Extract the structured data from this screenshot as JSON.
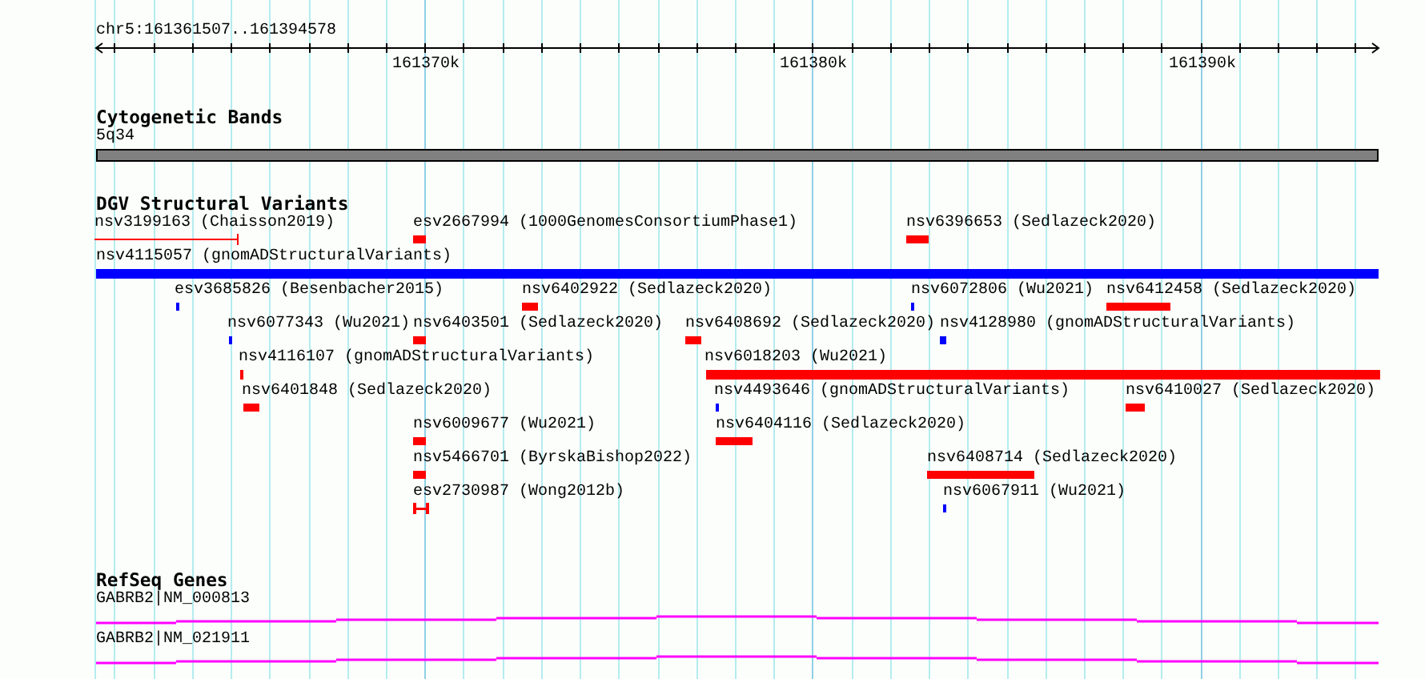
{
  "ruler": {
    "location": "chr5:161361507..161394578",
    "ticks": [
      "161370k",
      "161380k",
      "161390k"
    ]
  },
  "tracks": [
    {
      "kind": "bands",
      "title": "Cytogenetic Bands",
      "bands": [
        {
          "name": "5q34"
        }
      ]
    },
    {
      "kind": "variants",
      "title": "DGV Structural Variants",
      "features": [
        {
          "label": "nsv3199163 (Chaisson2019)",
          "color": "#ff0000",
          "kind": "line"
        },
        {
          "label": "esv2667994 (1000GenomesConsortiumPhase1)",
          "color": "#ff0000",
          "kind": "bar"
        },
        {
          "label": "nsv6396653 (Sedlazeck2020)",
          "color": "#ff0000",
          "kind": "bar"
        },
        {
          "label": "nsv4115057 (gnomADStructuralVariants)",
          "color": "#0000ff",
          "kind": "bar"
        },
        {
          "label": "esv3685826 (Besenbacher2015)",
          "color": "#0000ff",
          "kind": "bar"
        },
        {
          "label": "nsv6402922 (Sedlazeck2020)",
          "color": "#ff0000",
          "kind": "bar"
        },
        {
          "label": "nsv6072806 (Wu2021)",
          "color": "#0000ff",
          "kind": "bar"
        },
        {
          "label": "nsv6412458 (Sedlazeck2020)",
          "color": "#ff0000",
          "kind": "bar"
        },
        {
          "label": "nsv6077343 (Wu2021)",
          "color": "#0000ff",
          "kind": "bar"
        },
        {
          "label": "nsv6403501 (Sedlazeck2020)",
          "color": "#ff0000",
          "kind": "bar"
        },
        {
          "label": "nsv6408692 (Sedlazeck2020)",
          "color": "#ff0000",
          "kind": "bar"
        },
        {
          "label": "nsv4128980 (gnomADStructuralVariants)",
          "color": "#0000ff",
          "kind": "bar"
        },
        {
          "label": "nsv4116107 (gnomADStructuralVariants)",
          "color": "#ff0000",
          "kind": "bar"
        },
        {
          "label": "nsv6018203 (Wu2021)",
          "color": "#ff0000",
          "kind": "bar"
        },
        {
          "label": "nsv6401848 (Sedlazeck2020)",
          "color": "#ff0000",
          "kind": "bar"
        },
        {
          "label": "nsv4493646 (gnomADStructuralVariants)",
          "color": "#0000ff",
          "kind": "bar"
        },
        {
          "label": "nsv6410027 (Sedlazeck2020)",
          "color": "#ff0000",
          "kind": "bar"
        },
        {
          "label": "nsv6009677 (Wu2021)",
          "color": "#ff0000",
          "kind": "bar"
        },
        {
          "label": "nsv6404116 (Sedlazeck2020)",
          "color": "#ff0000",
          "kind": "bar"
        },
        {
          "label": "nsv5466701 (ByrskaBishop2022)",
          "color": "#ff0000",
          "kind": "bar"
        },
        {
          "label": "nsv6408714 (Sedlazeck2020)",
          "color": "#ff0000",
          "kind": "bar"
        },
        {
          "label": "esv2730987 (Wong2012b)",
          "color": "#ff0000",
          "kind": "span"
        },
        {
          "label": "nsv6067911 (Wu2021)",
          "color": "#0000ff",
          "kind": "bar"
        }
      ]
    },
    {
      "kind": "genes",
      "title": "RefSeq Genes",
      "transcripts": [
        {
          "label": "GABRB2|NM_000813"
        },
        {
          "label": "GABRB2|NM_021911"
        }
      ]
    }
  ]
}
